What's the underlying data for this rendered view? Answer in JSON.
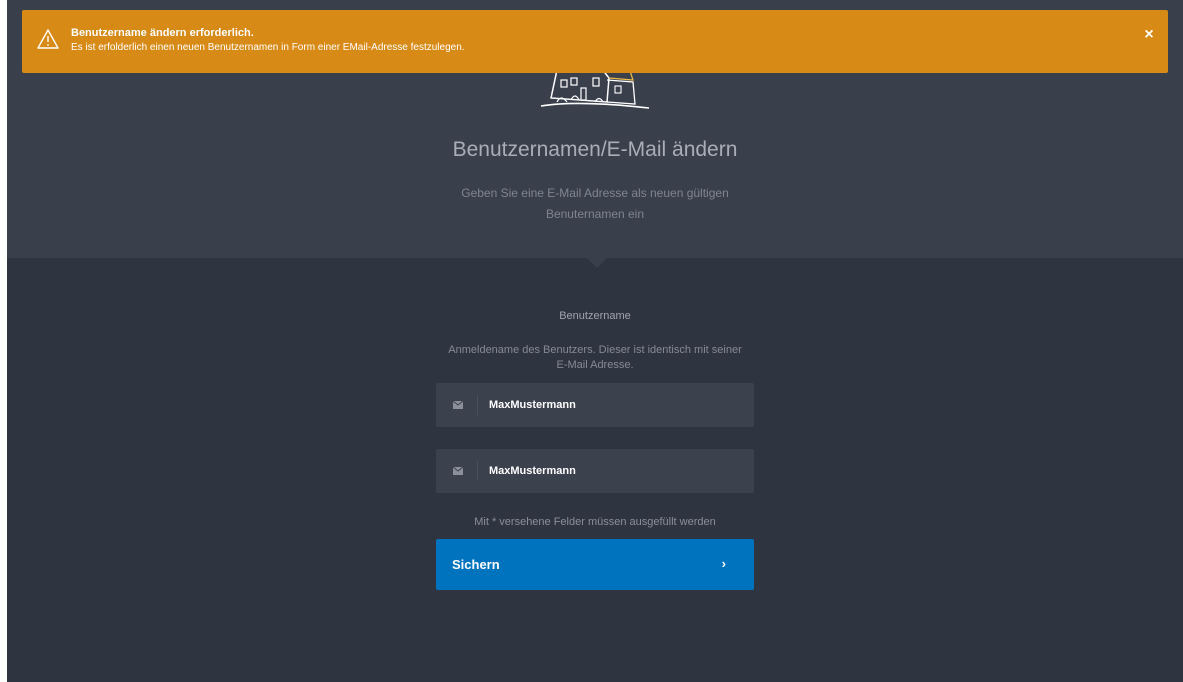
{
  "alert": {
    "title": "Benutzername ändern erforderlich.",
    "message": "Es ist erfolderlich einen neuen Benutzernamen in Form einer EMail-Adresse festzulegen.",
    "close_glyph": "×",
    "icon": "warning-icon",
    "color": "#d88a16"
  },
  "header": {
    "logo": "house-logo",
    "title": "Benutzernamen/E-Mail ändern",
    "subtitle": "Geben Sie eine E-Mail Adresse als neuen gültigen Benuternamen ein"
  },
  "form": {
    "label": "Benutzername",
    "help": "Anmeldename des Benutzers. Dieser ist identisch mit seiner E-Mail Adresse.",
    "input1_value": "MaxMustermann",
    "input2_value": "MaxMustermann",
    "field_icon": "mail-icon",
    "required_note": "Mit * versehene Felder müssen ausgefüllt werden",
    "save_label": "Sichern",
    "save_chevron": "›",
    "button_color": "#0073bf"
  }
}
